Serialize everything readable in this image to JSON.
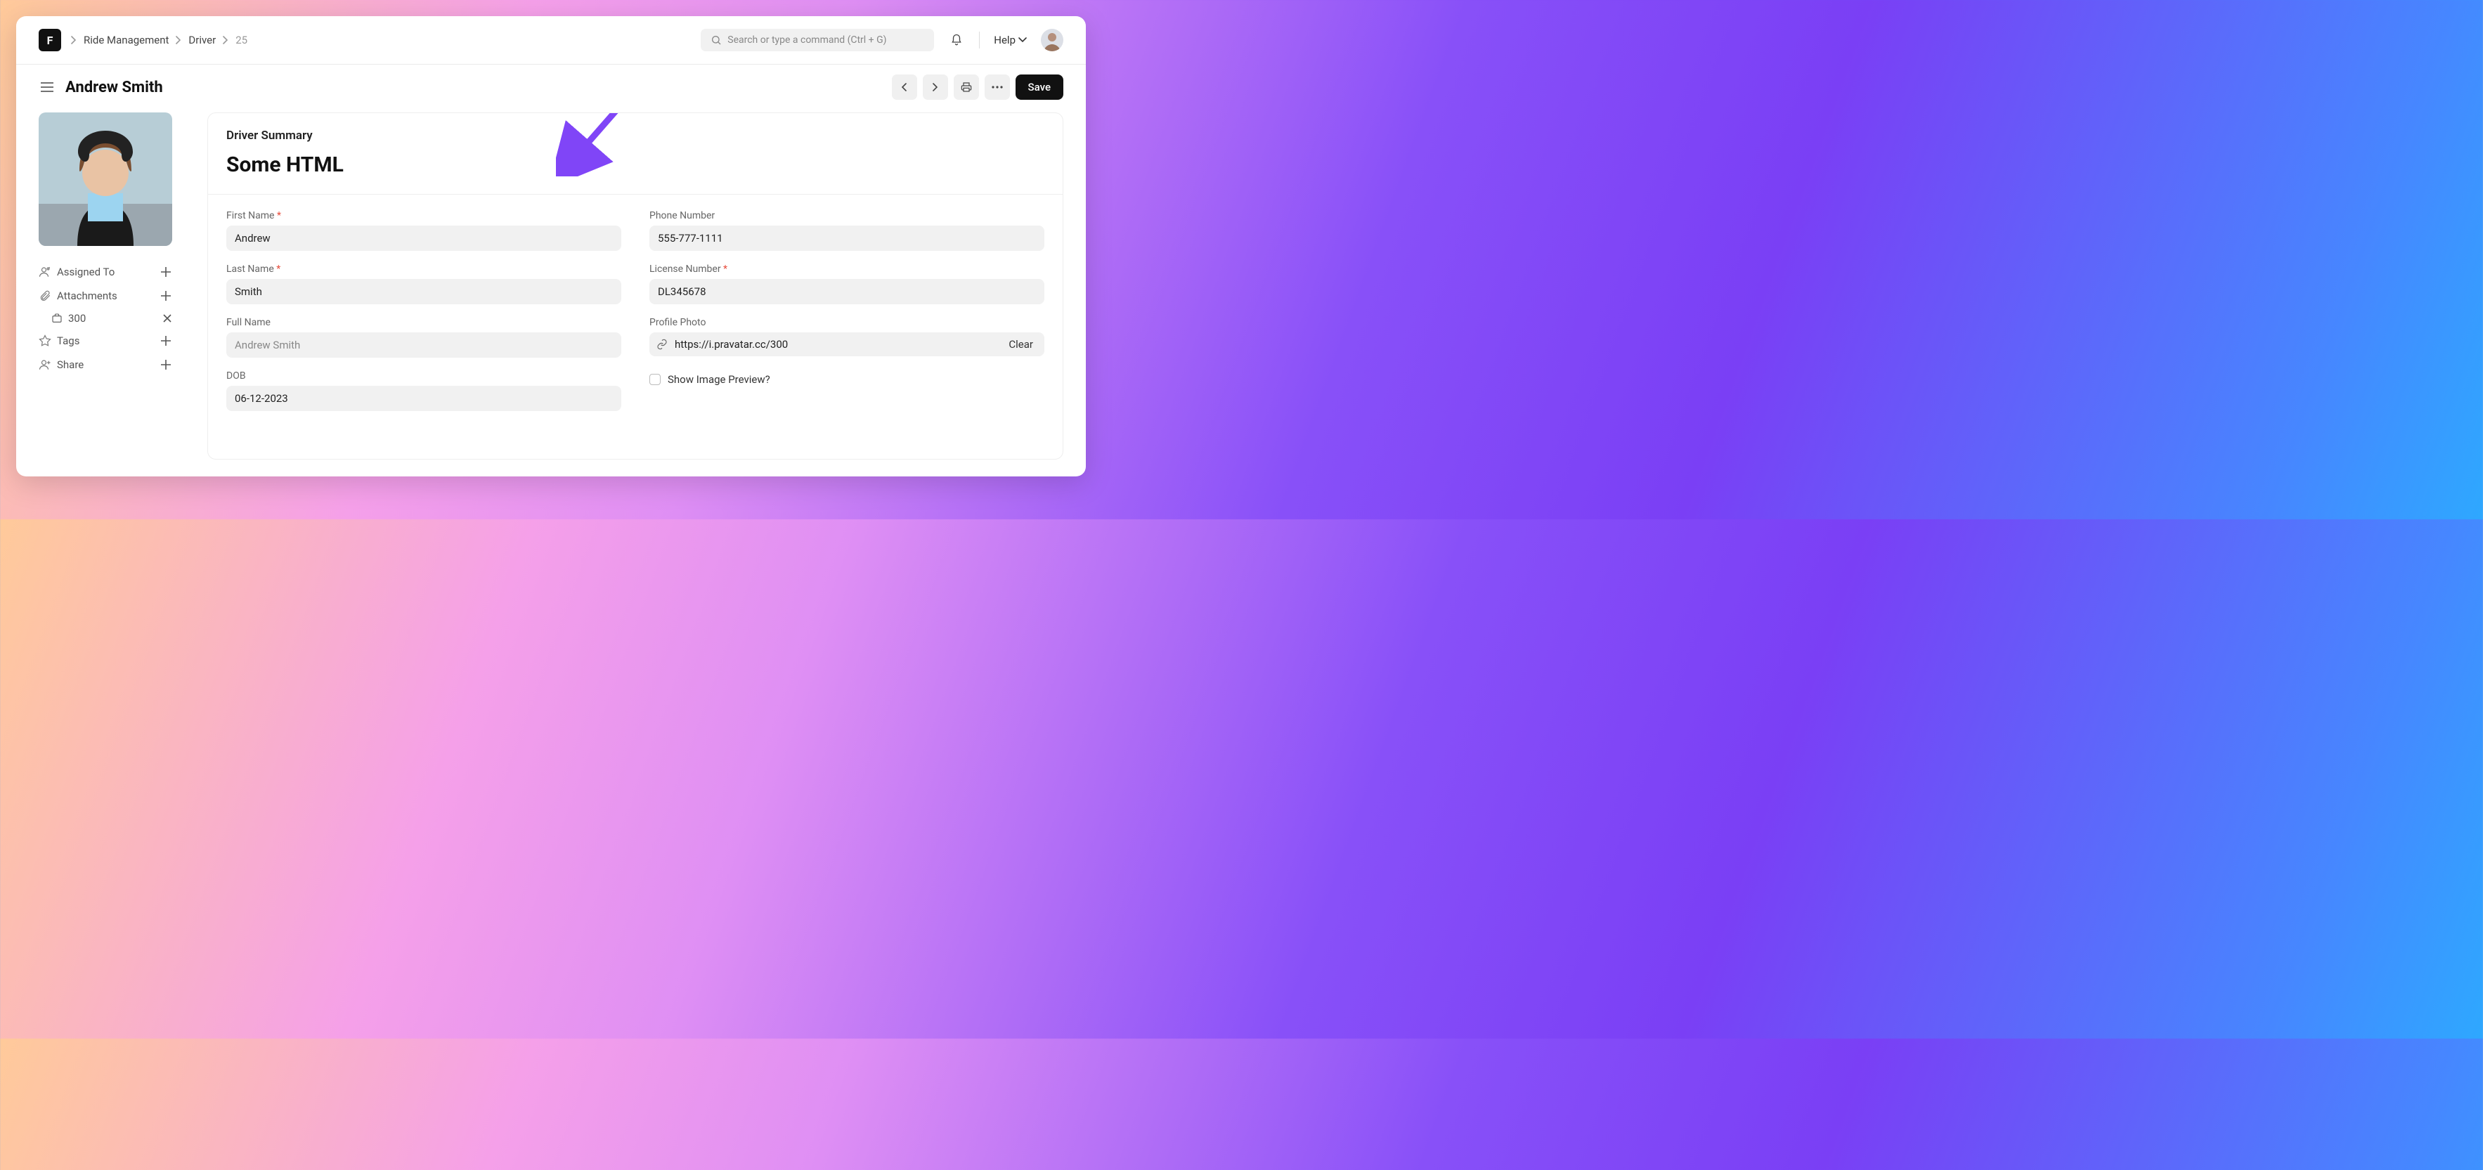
{
  "logo_letter": "F",
  "breadcrumb": {
    "a": "Ride Management",
    "b": "Driver",
    "c": "25"
  },
  "search": {
    "placeholder": "Search or type a command (Ctrl + G)"
  },
  "help_label": "Help",
  "page_title": "Andrew Smith",
  "save_label": "Save",
  "sidebar": {
    "assigned_to": "Assigned To",
    "attachments": "Attachments",
    "attachment_item": "300",
    "tags": "Tags",
    "share": "Share"
  },
  "card": {
    "section_title": "Driver Summary",
    "big_title": "Some HTML"
  },
  "fields": {
    "first_name": {
      "label": "First Name",
      "value": "Andrew",
      "required": true
    },
    "last_name": {
      "label": "Last Name",
      "value": "Smith",
      "required": true
    },
    "full_name": {
      "label": "Full Name",
      "value": "Andrew Smith"
    },
    "dob": {
      "label": "DOB",
      "value": "06-12-2023"
    },
    "phone": {
      "label": "Phone Number",
      "value": "555-777-1111"
    },
    "license": {
      "label": "License Number",
      "value": "DL345678",
      "required": true
    },
    "photo": {
      "label": "Profile Photo",
      "value": "https://i.pravatar.cc/300",
      "clear": "Clear"
    },
    "show_preview": {
      "label": "Show Image Preview?"
    }
  }
}
